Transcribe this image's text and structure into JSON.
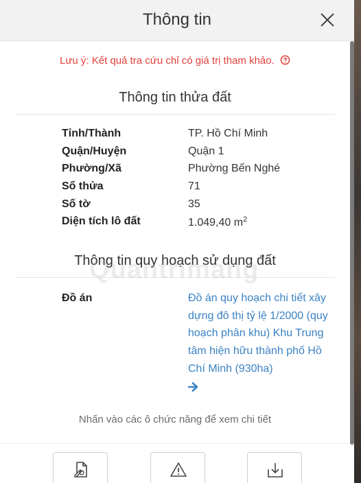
{
  "dialog": {
    "title": "Thông tin",
    "note": "Lưu ý: Kết quả tra cứu chỉ có giá trị tham khảo.",
    "parcel_section_title": "Thông tin thửa đất",
    "parcel_rows": [
      {
        "label": "Tỉnh/Thành",
        "value": "TP. Hồ Chí Minh"
      },
      {
        "label": "Quận/Huyện",
        "value": "Quận 1"
      },
      {
        "label": "Phường/Xã",
        "value": "Phường Bến Nghé"
      },
      {
        "label": "Số thửa",
        "value": "71"
      },
      {
        "label": "Số tờ",
        "value": "35"
      },
      {
        "label": "Diện tích lô đất",
        "value": "1.049,40 m",
        "unit_sup": "2"
      }
    ],
    "planning_section_title": "Thông tin quy hoạch sử dụng đất",
    "plan_label": "Đồ án",
    "plan_value": "Đồ án quy hoạch chi tiết xây dựng đô thị tỷ lệ 1/2000 (quy hoạch phân khu) Khu Trung tâm hiện hữu thành phố Hồ Chí Minh (930ha)",
    "hint": "Nhấn vào các ô chức năng để xem chi tiết",
    "watermark": "Quantrimang"
  },
  "colors": {
    "note_red": "#e0403a",
    "link_blue": "#3b82c4",
    "header_bg": "#f2f2f2"
  },
  "icons": {
    "close": "close-icon",
    "help": "question-circle-icon",
    "arrow": "arrow-right-icon",
    "actions": [
      "document-edit-icon",
      "warning-icon",
      "download-icon"
    ]
  }
}
